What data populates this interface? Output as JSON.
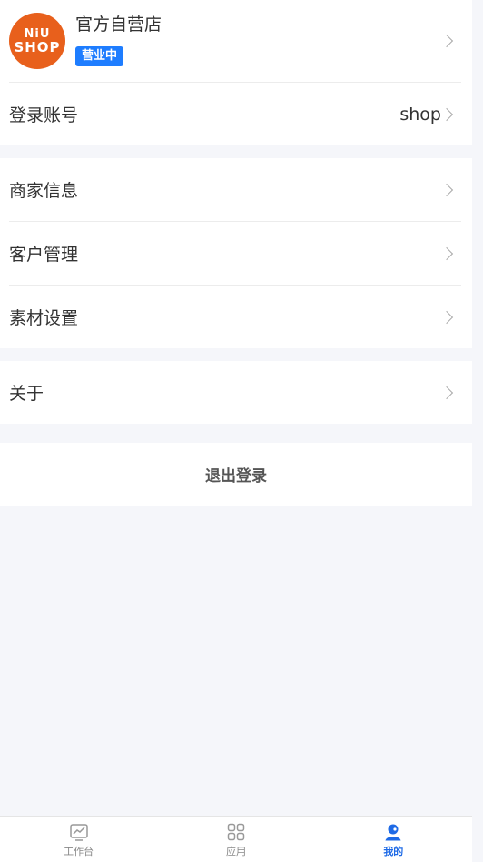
{
  "store": {
    "logo_line1": "NiU",
    "logo_line2": "SHOP",
    "name": "官方自营店",
    "status_badge": "营业中"
  },
  "login_account": {
    "label": "登录账号",
    "value": "shop"
  },
  "menu_group1": [
    {
      "label": "商家信息"
    },
    {
      "label": "客户管理"
    },
    {
      "label": "素材设置"
    }
  ],
  "menu_group2": [
    {
      "label": "关于"
    }
  ],
  "logout_label": "退出登录",
  "tabbar": {
    "items": [
      {
        "label": "工作台",
        "icon": "chart-icon",
        "active": false
      },
      {
        "label": "应用",
        "icon": "grid-icon",
        "active": false
      },
      {
        "label": "我的",
        "icon": "user-icon",
        "active": true
      }
    ]
  },
  "colors": {
    "accent": "#1e7dff",
    "logo_bg": "#e8601c",
    "background": "#f5f6fa",
    "tab_active": "#1e6ae6"
  }
}
